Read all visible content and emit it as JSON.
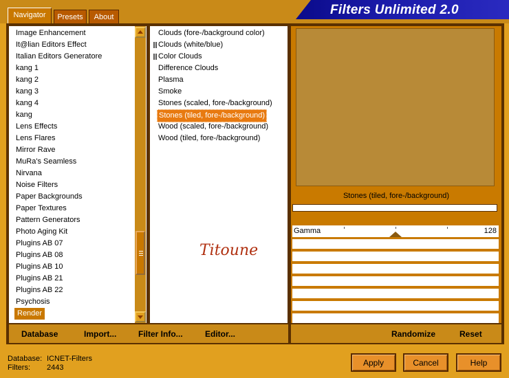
{
  "app": {
    "title": "Filters Unlimited 2.0"
  },
  "tabs": [
    {
      "label": "Navigator",
      "active": true
    },
    {
      "label": "Presets",
      "active": false
    },
    {
      "label": "About",
      "active": false
    }
  ],
  "categories": [
    "Image Enhancement",
    "It@lian Editors Effect",
    "Italian Editors Generatore",
    "kang 1",
    "kang 2",
    "kang 3",
    "kang 4",
    "kang",
    "Lens Effects",
    "Lens Flares",
    "Mirror Rave",
    "MuRa's Seamless",
    "Nirvana",
    "Noise Filters",
    "Paper Backgrounds",
    "Paper Textures",
    "Pattern Generators",
    "Photo Aging Kit",
    "Plugins AB 07",
    "Plugins AB 08",
    "Plugins AB 10",
    "Plugins AB 21",
    "Plugins AB 22",
    "Psychosis",
    "Render"
  ],
  "selected_category": "Render",
  "filters": [
    "Clouds (fore-/background color)",
    "Clouds (white/blue)",
    "Color Clouds",
    "Difference Clouds",
    "Plasma",
    "Smoke",
    "Stones (scaled, fore-/background)",
    "Stones (tiled, fore-/background)",
    "Wood (scaled, fore-/background)",
    "Wood (tiled, fore-/background)"
  ],
  "selected_filter": "Stones (tiled, fore-/background)",
  "watermark": "Titoune",
  "preview": {
    "filter_name": "Stones (tiled, fore-/background)",
    "color": "#b88a37"
  },
  "slider": {
    "label": "Gamma",
    "value": "128"
  },
  "bottom_links": {
    "database": "Database",
    "import": "Import...",
    "filter_info": "Filter Info...",
    "editor": "Editor..."
  },
  "right_links": {
    "randomize": "Randomize",
    "reset": "Reset"
  },
  "info": {
    "database_label": "Database:",
    "database_value": "ICNET-Filters",
    "filters_label": "Filters:",
    "filters_value": "2443"
  },
  "buttons": {
    "apply": "Apply",
    "cancel": "Cancel",
    "help": "Help"
  },
  "icons": {
    "scroll_up": "up-arrow-icon",
    "scroll_down": "down-arrow-icon"
  }
}
